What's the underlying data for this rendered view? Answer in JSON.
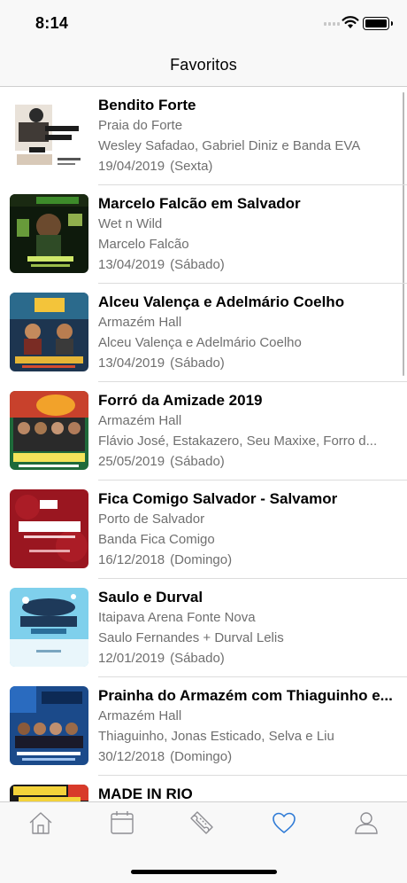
{
  "status_bar": {
    "time": "8:14",
    "signal_icon": "cellular-signal-icon",
    "wifi_icon": "wifi-icon",
    "battery_icon": "battery-icon"
  },
  "nav": {
    "title": "Favoritos"
  },
  "events": [
    {
      "title": "Bendito Forte",
      "venue": "Praia do Forte",
      "artists": "Wesley Safadao, Gabriel Diniz e Banda EVA",
      "date": "19/04/2019",
      "weekday": "(Sexta)"
    },
    {
      "title": "Marcelo Falcão em Salvador",
      "venue": "Wet n Wild",
      "artists": "Marcelo Falcão",
      "date": "13/04/2019",
      "weekday": "(Sábado)"
    },
    {
      "title": "Alceu Valença e Adelmário Coelho",
      "venue": "Armazém Hall",
      "artists": "Alceu Valença e Adelmário Coelho",
      "date": "13/04/2019",
      "weekday": "(Sábado)"
    },
    {
      "title": "Forró da Amizade 2019",
      "venue": "Armazém Hall",
      "artists": "Flávio José, Estakazero, Seu Maxixe, Forro d...",
      "date": "25/05/2019",
      "weekday": "(Sábado)"
    },
    {
      "title": "Fica Comigo Salvador - Salvamor",
      "venue": "Porto de Salvador",
      "artists": "Banda Fica Comigo",
      "date": "16/12/2018",
      "weekday": "(Domingo)"
    },
    {
      "title": "Saulo e Durval",
      "venue": "Itaipava Arena Fonte Nova",
      "artists": "Saulo Fernandes + Durval Lelis",
      "date": "12/01/2019",
      "weekday": "(Sábado)"
    },
    {
      "title": "Prainha do Armazém com Thiaguinho e...",
      "venue": "Armazém Hall",
      "artists": "Thiaguinho, Jonas Esticado, Selva e Liu",
      "date": "30/12/2018",
      "weekday": "(Domingo)"
    },
    {
      "title": "MADE IN RIO",
      "venue": "",
      "artists": "",
      "date": "",
      "weekday": ""
    }
  ],
  "tab_bar": {
    "active_color": "#2f7bd6",
    "inactive_color": "#8e8e93",
    "tabs": [
      {
        "icon": "home-icon",
        "active": false
      },
      {
        "icon": "calendar-icon",
        "active": false
      },
      {
        "icon": "ticket-icon",
        "active": false
      },
      {
        "icon": "heart-icon",
        "active": true
      },
      {
        "icon": "profile-icon",
        "active": false
      }
    ]
  }
}
